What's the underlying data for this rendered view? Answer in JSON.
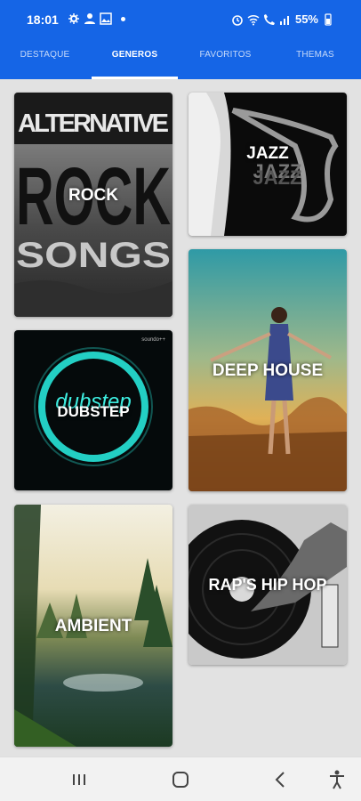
{
  "status": {
    "time": "18:01",
    "battery": "55%"
  },
  "tabs": [
    {
      "label": "DESTAQUE"
    },
    {
      "label": "GENEROS"
    },
    {
      "label": "FAVORITOS"
    },
    {
      "label": "THEMAS"
    }
  ],
  "genres": [
    {
      "label": "ROCK",
      "art_text": [
        "ALTERNATIVE",
        "ROCK",
        "SONGS"
      ]
    },
    {
      "label": "JAZZ",
      "art_text": [
        "JAZZ",
        "JAZZ"
      ]
    },
    {
      "label": "DEEP HOUSE"
    },
    {
      "label": "DUBSTEP",
      "art_text": [
        "dubstep",
        "soundo++"
      ]
    },
    {
      "label": "AMBIENT"
    },
    {
      "label": "RAP'S HIP HOP"
    }
  ],
  "icons": [
    "settings-icon",
    "person-icon",
    "image-icon",
    "alarm-icon",
    "wifi-icon",
    "call-icon",
    "signal-icon",
    "battery-icon",
    "recent-apps-icon",
    "home-icon",
    "back-icon",
    "accessibility-icon"
  ]
}
